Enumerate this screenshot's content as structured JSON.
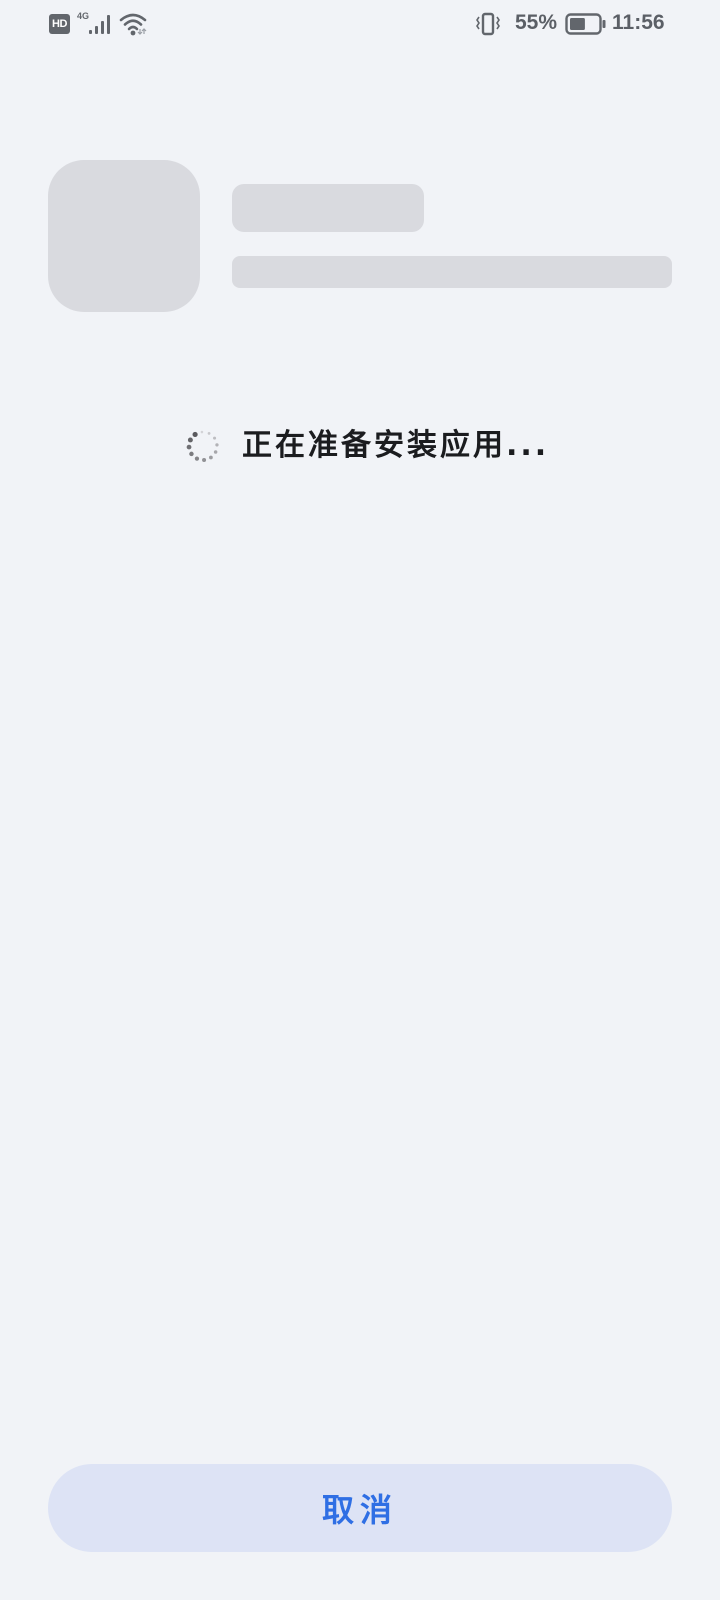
{
  "status_bar": {
    "hd_label": "HD",
    "network_type": "4G",
    "battery_percent": "55%",
    "battery_level": 0.55,
    "time": "11:56",
    "icons": {
      "signal": "cellular-signal-icon",
      "wifi": "wifi-icon",
      "vibrate": "vibrate-mode-icon",
      "battery": "battery-icon"
    }
  },
  "installer": {
    "status_text": "正在准备安装应用...",
    "spinner": "loading-spinner-icon"
  },
  "actions": {
    "cancel_label": "取消"
  },
  "colors": {
    "background": "#f1f3f7",
    "placeholder": "#d9dadf",
    "button_background": "#dde3f5",
    "accent": "#2f6fe4",
    "text_primary": "#1b1c1f",
    "status_icons": "#5b5f66"
  }
}
